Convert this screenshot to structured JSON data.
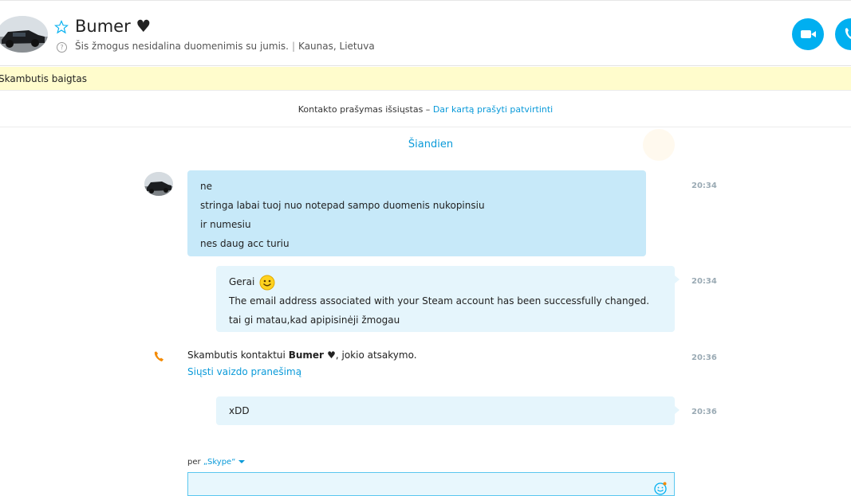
{
  "header": {
    "contact_name": "Bumer ♥",
    "status_text": "Šis žmogus nesidalina duomenimis su jumis.",
    "separator": "|",
    "location": "Kaunas, Lietuva",
    "icons": [
      "star-icon",
      "help-icon",
      "video-call-icon",
      "phone-call-icon"
    ]
  },
  "banner": {
    "text": "Skambutis baigtas"
  },
  "contact_request": {
    "text": "Kontakto prašymas išsiųstas –",
    "link": "Dar kartą prašyti patvirtinti"
  },
  "day_label": "Šiandien",
  "messages": [
    {
      "direction": "incoming",
      "lines": [
        "ne",
        "stringa labai tuoj nuo notepad sampo duomenis nukopinsiu",
        "ir numesiu",
        "nes daug acc turiu"
      ],
      "time": "20:34"
    },
    {
      "direction": "outgoing",
      "first_line": "Gerai",
      "emoticon": "smile-emoticon",
      "lines": [
        "The email address associated with your Steam account has been successfully changed.",
        "tai gi matau,kad apipisinėji žmogau"
      ],
      "time": "20:34"
    },
    {
      "type": "missed_call",
      "text_before": "Skambutis kontaktui",
      "contact": "Bumer ♥",
      "text_after": ", jokio atsakymo.",
      "link": "Siųsti vaizdo pranešimą",
      "time": "20:36"
    },
    {
      "direction": "outgoing",
      "lines": [
        "xDD"
      ],
      "time": "20:36"
    }
  ],
  "composer": {
    "via_label": "per",
    "service": "„Skype“",
    "value": ""
  },
  "colors": {
    "accent": "#00aff0",
    "link": "#0a9ad9",
    "incoming_bubble": "#c7e9f9",
    "outgoing_bubble": "#e5f5fc",
    "banner": "#fffccc"
  }
}
